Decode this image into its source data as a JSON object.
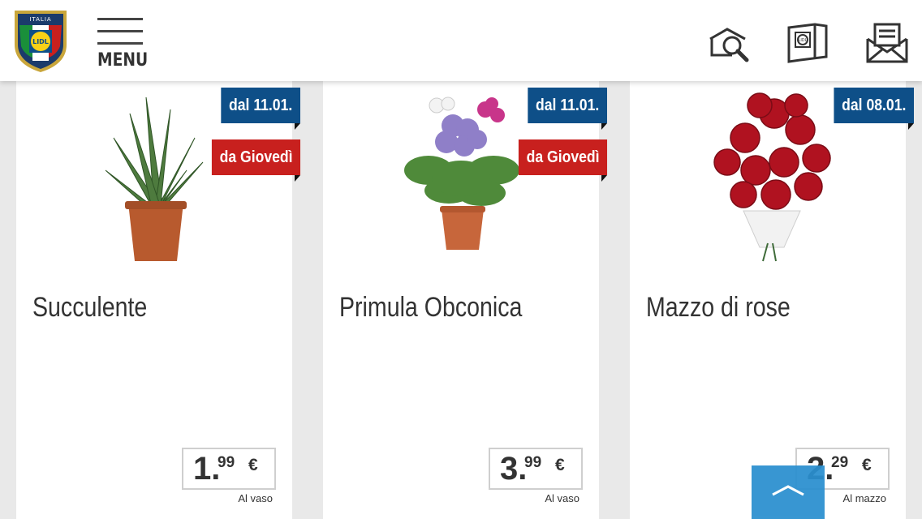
{
  "header": {
    "menu_label": "MENU",
    "logo_icon": "lidl-italia-shield-logo",
    "icons": [
      "flyer-search-icon",
      "leaflet-icon",
      "newsletter-icon"
    ]
  },
  "cards": [
    {
      "title": "Succulente",
      "badges": [
        "dal 11.01.",
        "da Giovedì"
      ],
      "price_int": "1.",
      "price_dec": "99",
      "currency": "€",
      "unit": "Al vaso",
      "image": "aloe-plant-image"
    },
    {
      "title": "Primula Obconica",
      "badges": [
        "dal 11.01.",
        "da Giovedì"
      ],
      "price_int": "3.",
      "price_dec": "99",
      "currency": "€",
      "unit": "Al vaso",
      "image": "primula-plant-image"
    },
    {
      "title": "Mazzo di rose",
      "badges": [
        "dal 08.01."
      ],
      "price_int": "2.",
      "price_dec": "29",
      "currency": "€",
      "unit": "Al mazzo",
      "image": "roses-bouquet-image"
    }
  ],
  "colors": {
    "badge_blue": "#0e4f88",
    "badge_red": "#c8201e",
    "scroll_top": "#2a8fcf"
  }
}
